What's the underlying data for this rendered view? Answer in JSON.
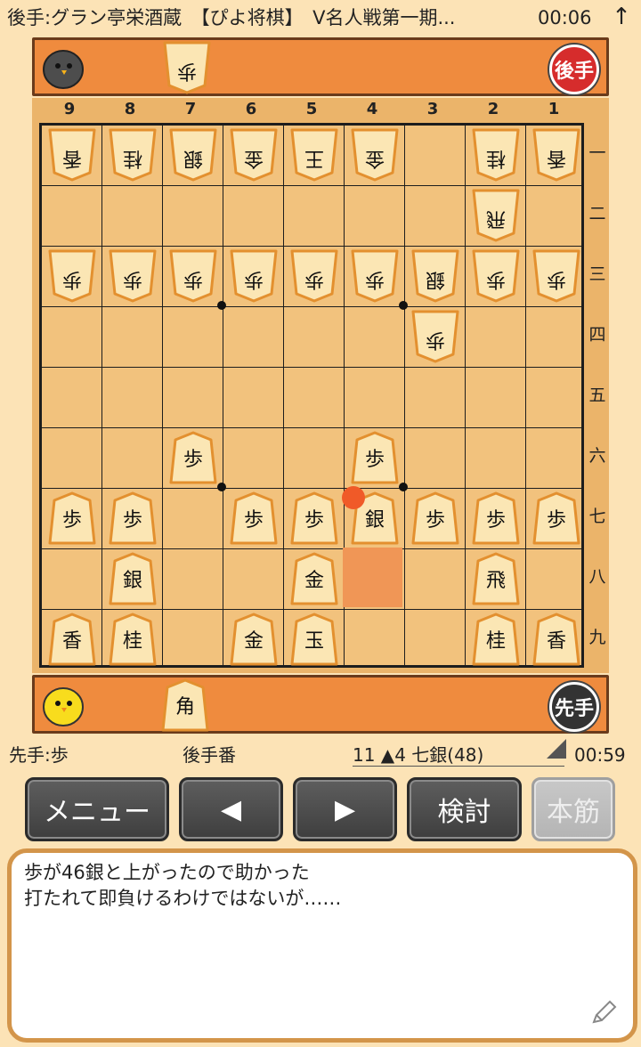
{
  "header": {
    "title": "後手:グラン亭栄酒蔵　【ぴよ将棋】　V名人戦第一期...",
    "clock": "00:06",
    "arrow": "↑"
  },
  "gote": {
    "badge": "後手",
    "hand": [
      {
        "char": "歩"
      }
    ]
  },
  "sente": {
    "badge": "先手",
    "hand": [
      {
        "char": "角"
      }
    ]
  },
  "board": {
    "columns": [
      "9",
      "8",
      "7",
      "6",
      "5",
      "4",
      "3",
      "2",
      "1"
    ],
    "rows": [
      "一",
      "二",
      "三",
      "四",
      "五",
      "六",
      "七",
      "八",
      "九"
    ],
    "last_move_square": {
      "file": 4,
      "rank": 8
    },
    "pieces": [
      {
        "file": 9,
        "rank": 1,
        "char": "香",
        "side": "gote"
      },
      {
        "file": 8,
        "rank": 1,
        "char": "桂",
        "side": "gote"
      },
      {
        "file": 7,
        "rank": 1,
        "char": "銀",
        "side": "gote"
      },
      {
        "file": 6,
        "rank": 1,
        "char": "金",
        "side": "gote"
      },
      {
        "file": 5,
        "rank": 1,
        "char": "王",
        "side": "gote"
      },
      {
        "file": 4,
        "rank": 1,
        "char": "金",
        "side": "gote"
      },
      {
        "file": 2,
        "rank": 1,
        "char": "桂",
        "side": "gote"
      },
      {
        "file": 1,
        "rank": 1,
        "char": "香",
        "side": "gote"
      },
      {
        "file": 2,
        "rank": 2,
        "char": "飛",
        "side": "gote"
      },
      {
        "file": 9,
        "rank": 3,
        "char": "歩",
        "side": "gote"
      },
      {
        "file": 8,
        "rank": 3,
        "char": "歩",
        "side": "gote"
      },
      {
        "file": 7,
        "rank": 3,
        "char": "歩",
        "side": "gote"
      },
      {
        "file": 6,
        "rank": 3,
        "char": "歩",
        "side": "gote"
      },
      {
        "file": 5,
        "rank": 3,
        "char": "歩",
        "side": "gote"
      },
      {
        "file": 4,
        "rank": 3,
        "char": "歩",
        "side": "gote"
      },
      {
        "file": 3,
        "rank": 3,
        "char": "銀",
        "side": "gote"
      },
      {
        "file": 2,
        "rank": 3,
        "char": "歩",
        "side": "gote"
      },
      {
        "file": 1,
        "rank": 3,
        "char": "歩",
        "side": "gote"
      },
      {
        "file": 3,
        "rank": 4,
        "char": "歩",
        "side": "gote"
      },
      {
        "file": 7,
        "rank": 6,
        "char": "歩",
        "side": "sente"
      },
      {
        "file": 4,
        "rank": 6,
        "char": "歩",
        "side": "sente"
      },
      {
        "file": 9,
        "rank": 7,
        "char": "歩",
        "side": "sente"
      },
      {
        "file": 8,
        "rank": 7,
        "char": "歩",
        "side": "sente"
      },
      {
        "file": 6,
        "rank": 7,
        "char": "歩",
        "side": "sente"
      },
      {
        "file": 5,
        "rank": 7,
        "char": "歩",
        "side": "sente"
      },
      {
        "file": 4,
        "rank": 7,
        "char": "銀",
        "side": "sente"
      },
      {
        "file": 3,
        "rank": 7,
        "char": "歩",
        "side": "sente"
      },
      {
        "file": 2,
        "rank": 7,
        "char": "歩",
        "side": "sente"
      },
      {
        "file": 1,
        "rank": 7,
        "char": "歩",
        "side": "sente"
      },
      {
        "file": 8,
        "rank": 8,
        "char": "銀",
        "side": "sente"
      },
      {
        "file": 5,
        "rank": 8,
        "char": "金",
        "side": "sente"
      },
      {
        "file": 2,
        "rank": 8,
        "char": "飛",
        "side": "sente"
      },
      {
        "file": 9,
        "rank": 9,
        "char": "香",
        "side": "sente"
      },
      {
        "file": 8,
        "rank": 9,
        "char": "桂",
        "side": "sente"
      },
      {
        "file": 6,
        "rank": 9,
        "char": "金",
        "side": "sente"
      },
      {
        "file": 5,
        "rank": 9,
        "char": "玉",
        "side": "sente"
      },
      {
        "file": 2,
        "rank": 9,
        "char": "桂",
        "side": "sente"
      },
      {
        "file": 1,
        "rank": 9,
        "char": "香",
        "side": "sente"
      }
    ]
  },
  "status": {
    "sente_hand": "先手:歩",
    "turn": "後手番",
    "move": "11 ▲4 七銀(48)",
    "clock": "00:59"
  },
  "buttons": {
    "menu": "メニュー",
    "prev": "◀",
    "next": "▶",
    "analyze": "検討",
    "mainline": "本筋"
  },
  "comment": {
    "line1": "歩が46銀と上がったので助かった",
    "line2": "打たれて即負けるわけではないが……"
  },
  "colors": {
    "board": "#f2c27d",
    "stand": "#ef8b3e",
    "highlight": "#f09656",
    "gote_badge": "#d62c2c",
    "sente_badge": "#333333"
  }
}
